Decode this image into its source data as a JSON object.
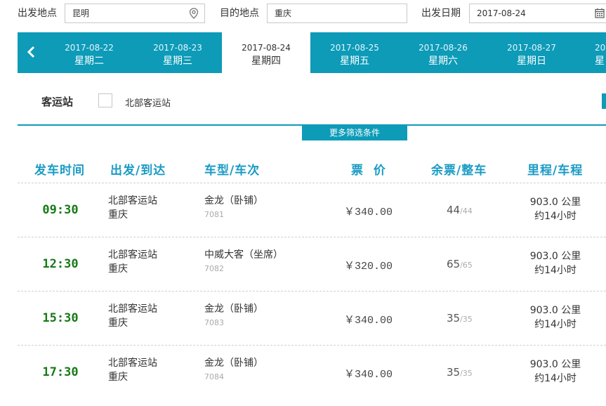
{
  "search": {
    "from_label": "出发地点",
    "from_value": "昆明",
    "to_label": "目的地点",
    "to_value": "重庆",
    "date_label": "出发日期",
    "date_value": "2017-08-24"
  },
  "datebar": {
    "tabs": [
      {
        "date": "2017-08-22",
        "weekday": "星期二"
      },
      {
        "date": "2017-08-23",
        "weekday": "星期三"
      },
      {
        "date": "2017-08-24",
        "weekday": "星期四"
      },
      {
        "date": "2017-08-25",
        "weekday": "星期五"
      },
      {
        "date": "2017-08-26",
        "weekday": "星期六"
      },
      {
        "date": "2017-08-27",
        "weekday": "星期日"
      },
      {
        "date": "20",
        "weekday": "星"
      }
    ],
    "active_index": 2
  },
  "filter": {
    "station_label": "客运站",
    "station_option": "北部客运站",
    "more_button": "更多筛选条件"
  },
  "table": {
    "headers": {
      "time": "发车时间",
      "route": "出发/到达",
      "bus": "车型/车次",
      "price": "票  价",
      "seats": "余票/整车",
      "distance": "里程/车程"
    },
    "rows": [
      {
        "time": "09:30",
        "from": "北部客运站",
        "to": "重庆",
        "bus_type": "金龙（卧铺）",
        "bus_no": "7081",
        "price": "￥340.00",
        "seats_left": "44",
        "seats_total": "/44",
        "distance": "903.0 公里",
        "duration": "约14小时"
      },
      {
        "time": "12:30",
        "from": "北部客运站",
        "to": "重庆",
        "bus_type": "中威大客（坐席）",
        "bus_no": "7082",
        "price": "￥320.00",
        "seats_left": "65",
        "seats_total": "/65",
        "distance": "903.0 公里",
        "duration": "约14小时"
      },
      {
        "time": "15:30",
        "from": "北部客运站",
        "to": "重庆",
        "bus_type": "金龙（卧铺）",
        "bus_no": "7083",
        "price": "￥340.00",
        "seats_left": "35",
        "seats_total": "/35",
        "distance": "903.0 公里",
        "duration": "约14小时"
      },
      {
        "time": "17:30",
        "from": "北部客运站",
        "to": "重庆",
        "bus_type": "金龙（卧铺）",
        "bus_no": "7084",
        "price": "￥340.00",
        "seats_left": "35",
        "seats_total": "/35",
        "distance": "903.0 公里",
        "duration": "约14小时"
      }
    ]
  },
  "colors": {
    "accent": "#0d9bb8",
    "header_text": "#1a9bc4",
    "time_text": "#177a17"
  },
  "icons": {
    "location": "map-pin-icon",
    "calendar": "calendar-icon",
    "prev": "chevron-left-icon"
  }
}
